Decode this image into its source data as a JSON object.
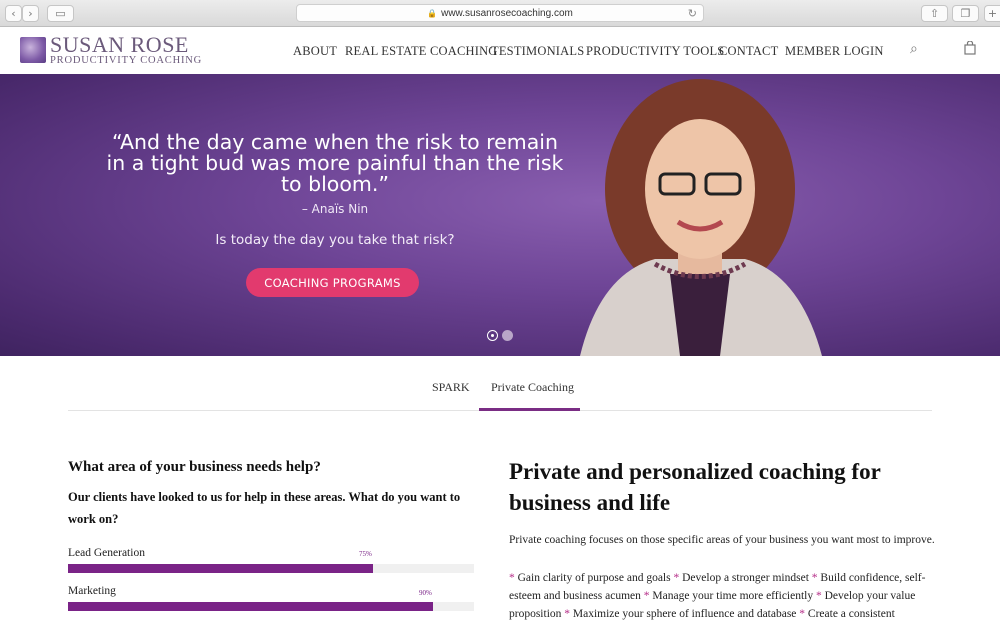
{
  "browser": {
    "url": "www.susanrosecoaching.com",
    "back_icon": "chevron-left-icon",
    "forward_icon": "chevron-right-icon",
    "sidebar_icon": "sidebar-icon",
    "share_icon": "share-icon",
    "tabs_icon": "tabs-icon",
    "new_tab_icon": "plus-icon"
  },
  "header": {
    "logo_name": "SUSAN ROSE",
    "logo_tagline": "PRODUCTIVITY COACHING",
    "nav": [
      "ABOUT",
      "REAL ESTATE COACHING",
      "TESTIMONIALS",
      "PRODUCTIVITY TOOLS",
      "CONTACT",
      "MEMBER LOGIN"
    ],
    "search_icon": "search-icon",
    "cart_icon": "shopping-bag-icon"
  },
  "hero": {
    "quote": "“And the day came when the risk to remain in a tight bud was more painful than the risk to bloom.”",
    "author": "– Anaïs Nin",
    "question": "Is today the day you take that risk?",
    "cta_label": "COACHING PROGRAMS",
    "background_color": "#6e4596",
    "slide_count": 2,
    "active_slide": 1
  },
  "tabs": {
    "items": [
      "SPARK",
      "Private Coaching"
    ],
    "active": "Private Coaching",
    "accent": "#7a2d84"
  },
  "left": {
    "title": "What area of your business needs help?",
    "subtitle": "Our clients have looked to us for help in these areas. What do you want to work on?",
    "bars": [
      {
        "label": "Lead Generation",
        "percent_label": "75%",
        "value": 75
      },
      {
        "label": "Marketing",
        "percent_label": "90%",
        "value": 90
      }
    ],
    "bar_color": "#7a2387"
  },
  "right": {
    "title": "Private and personalized coaching for business and life",
    "intro": "Private coaching focuses on those specific areas of your business you want most to improve.",
    "bullet_marker": "*",
    "bullets": [
      "Gain clarity of purpose and goals",
      "Develop a stronger mindset",
      "Build confidence, self-esteem and business acumen",
      "Manage your time more efficiently",
      "Develop your value proposition",
      "Maximize your sphere of influence and database",
      "Create a consistent pipeline"
    ]
  }
}
